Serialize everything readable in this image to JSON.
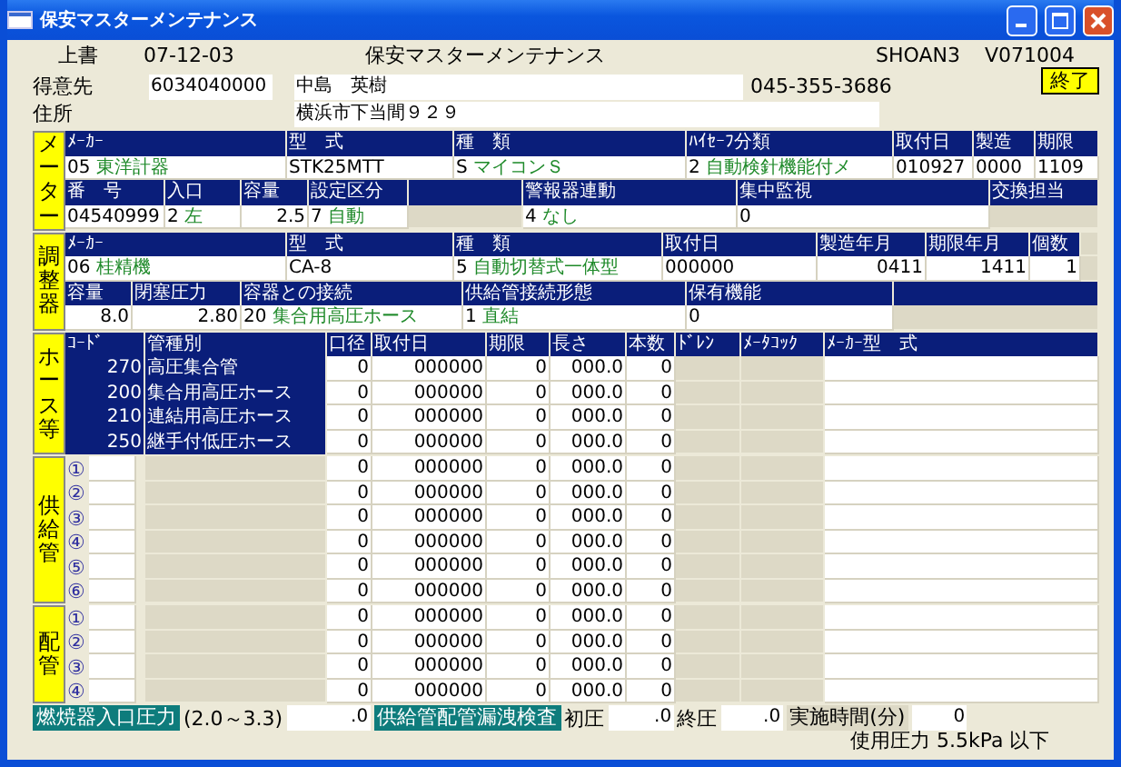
{
  "window": {
    "title": "保安マスターメンテナンス"
  },
  "header": {
    "mode": "上書",
    "date": "07-12-03",
    "title": "保安マスターメンテナンス",
    "user": "SHOAN3",
    "version": "V071004"
  },
  "exit_button": "終了",
  "customer": {
    "label": "得意先",
    "code": "6034040000",
    "name": "中島　英樹",
    "phone": "045-355-3686",
    "address_label": "住所",
    "address": "横浜市下当間９２９"
  },
  "sections": [
    {
      "label": "メーター",
      "rows": [
        [
          {
            "kind": "head",
            "text": "ﾒｰｶｰ"
          },
          {
            "kind": "head",
            "text": "型　式"
          },
          {
            "kind": "head",
            "text": "種　類"
          },
          {
            "kind": "head",
            "text": "ﾊｲｾｰﾌ分類"
          },
          {
            "kind": "head",
            "text": "取付日"
          },
          {
            "kind": "head",
            "text": "製造"
          },
          {
            "kind": "head",
            "text": "期限"
          }
        ],
        [
          {
            "kind": "coded",
            "code": "05",
            "name": "東洋計器"
          },
          {
            "kind": "text",
            "text": "STK25MTT"
          },
          {
            "kind": "coded",
            "code": "S",
            "name": "マイコンＳ"
          },
          {
            "kind": "coded",
            "code": "2",
            "name": "自動検針機能付メ"
          },
          {
            "kind": "text",
            "text": "010927"
          },
          {
            "kind": "text",
            "text": "0000"
          },
          {
            "kind": "text",
            "text": "1109"
          }
        ],
        [
          {
            "kind": "head",
            "text": "番　号"
          },
          {
            "kind": "head",
            "text": "入口"
          },
          {
            "kind": "head",
            "text": "容量"
          },
          {
            "kind": "head",
            "text": "設定区分"
          },
          {
            "kind": "blank"
          },
          {
            "kind": "head",
            "text": "警報器連動"
          },
          {
            "kind": "head",
            "text": "集中監視"
          },
          {
            "kind": "head",
            "text": "交換担当"
          }
        ],
        [
          {
            "kind": "text",
            "text": "04540999"
          },
          {
            "kind": "coded",
            "code": "2",
            "name": "左"
          },
          {
            "kind": "number",
            "text": "2.5"
          },
          {
            "kind": "coded",
            "code": "7",
            "name": "自動"
          },
          {
            "kind": "empty"
          },
          {
            "kind": "coded",
            "code": "4",
            "name": "なし"
          },
          {
            "kind": "text",
            "text": "0"
          },
          {
            "kind": "empty"
          }
        ]
      ]
    },
    {
      "label": "調整器",
      "rows": [
        [
          {
            "kind": "head",
            "text": "ﾒｰｶｰ"
          },
          {
            "kind": "head",
            "text": "型　式"
          },
          {
            "kind": "head",
            "text": "種　類"
          },
          {
            "kind": "head",
            "text": "取付日"
          },
          {
            "kind": "head",
            "text": "製造年月"
          },
          {
            "kind": "head",
            "text": "期限年月"
          },
          {
            "kind": "head",
            "text": "個数"
          },
          {
            "kind": "empty"
          }
        ],
        [
          {
            "kind": "coded",
            "code": "06",
            "name": "桂精機"
          },
          {
            "kind": "text",
            "text": "CA-8"
          },
          {
            "kind": "coded",
            "code": "5",
            "name": "自動切替式一体型"
          },
          {
            "kind": "text",
            "text": "000000"
          },
          {
            "kind": "number",
            "text": "0411"
          },
          {
            "kind": "number",
            "text": "1411"
          },
          {
            "kind": "number",
            "text": "1"
          },
          {
            "kind": "empty"
          }
        ],
        [
          {
            "kind": "head",
            "text": "容量"
          },
          {
            "kind": "head",
            "text": "閉塞圧力"
          },
          {
            "kind": "head",
            "text": "容器との接続"
          },
          {
            "kind": "head",
            "text": "供給管接続形態"
          },
          {
            "kind": "head",
            "text": "保有機能"
          },
          {
            "kind": "blank"
          }
        ],
        [
          {
            "kind": "number",
            "text": "8.0"
          },
          {
            "kind": "number",
            "text": "2.80"
          },
          {
            "kind": "coded",
            "code": "20",
            "name": "集合用高圧ホース"
          },
          {
            "kind": "coded",
            "code": "1",
            "name": "直結"
          },
          {
            "kind": "text",
            "text": "0"
          },
          {
            "kind": "empty"
          }
        ]
      ]
    }
  ],
  "hose_table": {
    "columns": [
      "ｺｰﾄﾞ",
      "管種別",
      "口径",
      "取付日",
      "期限",
      "長さ",
      "本数",
      "ﾄﾞﾚﾝ",
      "ﾒｰﾀｺｯｸ",
      "ﾒｰｶｰ型　式"
    ],
    "groups": [
      {
        "label": "ホース等",
        "rows": [
          {
            "kind": "hose",
            "code": "270",
            "type": "高圧集合管",
            "diameter": "0",
            "installed": "000000",
            "expiry": "0",
            "length": "000.0",
            "count": "0"
          },
          {
            "kind": "hose",
            "code": "200",
            "type": "集合用高圧ホース",
            "diameter": "0",
            "installed": "000000",
            "expiry": "0",
            "length": "000.0",
            "count": "0"
          },
          {
            "kind": "hose",
            "code": "210",
            "type": "連結用高圧ホース",
            "diameter": "0",
            "installed": "000000",
            "expiry": "0",
            "length": "000.0",
            "count": "0"
          },
          {
            "kind": "hose",
            "code": "250",
            "type": "継手付低圧ホース",
            "diameter": "0",
            "installed": "000000",
            "expiry": "0",
            "length": "000.0",
            "count": "0"
          }
        ]
      },
      {
        "label": "供給管",
        "rows": [
          {
            "kind": "pipe",
            "number": "①",
            "diameter": "0",
            "installed": "000000",
            "expiry": "0",
            "length": "000.0",
            "count": "0"
          },
          {
            "kind": "pipe",
            "number": "②",
            "diameter": "0",
            "installed": "000000",
            "expiry": "0",
            "length": "000.0",
            "count": "0"
          },
          {
            "kind": "pipe",
            "number": "③",
            "diameter": "0",
            "installed": "000000",
            "expiry": "0",
            "length": "000.0",
            "count": "0"
          },
          {
            "kind": "pipe",
            "number": "④",
            "diameter": "0",
            "installed": "000000",
            "expiry": "0",
            "length": "000.0",
            "count": "0"
          },
          {
            "kind": "pipe",
            "number": "⑤",
            "diameter": "0",
            "installed": "000000",
            "expiry": "0",
            "length": "000.0",
            "count": "0"
          },
          {
            "kind": "pipe",
            "number": "⑥",
            "diameter": "0",
            "installed": "000000",
            "expiry": "0",
            "length": "000.0",
            "count": "0"
          }
        ]
      },
      {
        "label": "配管",
        "rows": [
          {
            "kind": "pipe",
            "number": "①",
            "diameter": "0",
            "installed": "000000",
            "expiry": "0",
            "length": "000.0",
            "count": "0"
          },
          {
            "kind": "pipe",
            "number": "②",
            "diameter": "0",
            "installed": "000000",
            "expiry": "0",
            "length": "000.0",
            "count": "0"
          },
          {
            "kind": "pipe",
            "number": "③",
            "diameter": "0",
            "installed": "000000",
            "expiry": "0",
            "length": "000.0",
            "count": "0"
          },
          {
            "kind": "pipe",
            "number": "④",
            "diameter": "0",
            "installed": "000000",
            "expiry": "0",
            "length": "000.0",
            "count": "0"
          }
        ]
      }
    ]
  },
  "footer": {
    "burner_label": "燃焼器入口圧力",
    "range": "(2.0～3.3)",
    "burner_value": ".0",
    "leak_label": "供給管配管漏洩検査",
    "initial_label": "初圧",
    "initial_value": ".0",
    "final_label": "終圧",
    "final_value": ".0",
    "time_label": "実施時間(分)",
    "time_value": "0",
    "note": "使用圧力 5.5kPa 以下"
  }
}
